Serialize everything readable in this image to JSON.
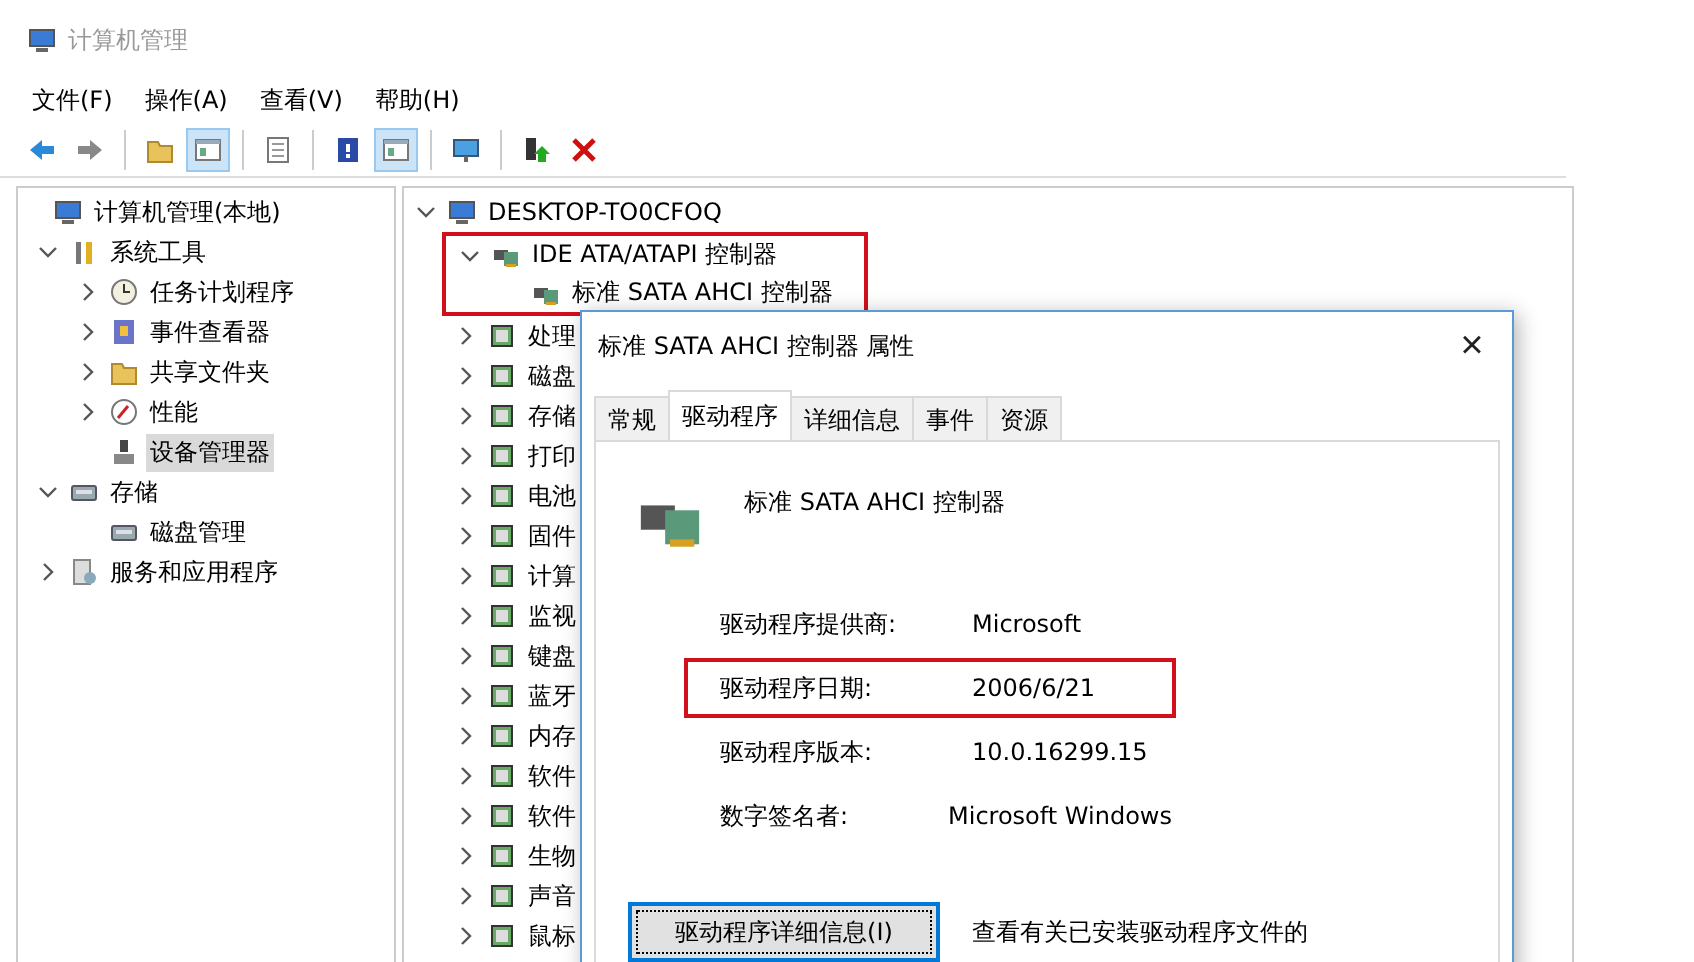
{
  "window": {
    "title": "计算机管理"
  },
  "menu": [
    "文件(F)",
    "操作(A)",
    "查看(V)",
    "帮助(H)"
  ],
  "toolbar": [
    [
      {
        "pressed": false
      },
      {
        "pressed": false
      }
    ],
    [
      {
        "pressed": false
      },
      {
        "pressed": true
      }
    ],
    [
      {
        "pressed": false
      }
    ],
    [
      {
        "pressed": false
      },
      {
        "pressed": true
      }
    ],
    [
      {
        "pressed": false
      }
    ],
    [
      {
        "pressed": false
      },
      {
        "pressed": false
      }
    ]
  ],
  "console_tree": [
    {
      "label": "计算机管理(本地)",
      "selected": false,
      "children": [
        {
          "label": "系统工具",
          "expanded": true,
          "selected": false,
          "children": [
            {
              "label": "任务计划程序",
              "expanded": false,
              "selected": false
            },
            {
              "label": "事件查看器",
              "expanded": false,
              "selected": false
            },
            {
              "label": "共享文件夹",
              "expanded": false,
              "selected": false
            },
            {
              "label": "性能",
              "expanded": false,
              "selected": false
            },
            {
              "label": "设备管理器",
              "selected": true
            }
          ]
        },
        {
          "label": "存储",
          "expanded": true,
          "selected": false,
          "children": [
            {
              "label": "磁盘管理",
              "selected": false
            }
          ]
        },
        {
          "label": "服务和应用程序",
          "expanded": false,
          "selected": false
        }
      ]
    }
  ],
  "device_tree": [
    {
      "label": "DESKTOP-TO0CFOQ",
      "expanded": true,
      "highlighted": false,
      "children": [
        {
          "label": "IDE ATA/ATAPI 控制器",
          "expanded": true,
          "highlighted": true,
          "children": [
            {
              "label": "标准 SATA AHCI 控制器",
              "highlighted": false
            }
          ]
        },
        {
          "label": "处理",
          "expanded": false,
          "highlighted": false
        },
        {
          "label": "磁盘",
          "expanded": false,
          "highlighted": false
        },
        {
          "label": "存储",
          "expanded": false,
          "highlighted": false
        },
        {
          "label": "打印",
          "expanded": false,
          "highlighted": false
        },
        {
          "label": "电池",
          "expanded": false,
          "highlighted": false
        },
        {
          "label": "固件",
          "expanded": false,
          "highlighted": false
        },
        {
          "label": "计算",
          "expanded": false,
          "highlighted": false
        },
        {
          "label": "监视",
          "expanded": false,
          "highlighted": false
        },
        {
          "label": "键盘",
          "expanded": false,
          "highlighted": false
        },
        {
          "label": "蓝牙",
          "expanded": false,
          "highlighted": false
        },
        {
          "label": "内存",
          "expanded": false,
          "highlighted": false
        },
        {
          "label": "软件",
          "expanded": false,
          "highlighted": false
        },
        {
          "label": "软件",
          "expanded": false,
          "highlighted": false
        },
        {
          "label": "生物",
          "expanded": false,
          "highlighted": false
        },
        {
          "label": "声音",
          "expanded": false,
          "highlighted": false
        },
        {
          "label": "鼠标",
          "expanded": false,
          "highlighted": false
        }
      ]
    }
  ],
  "dialog": {
    "title": "标准 SATA AHCI 控制器 属性",
    "close": "×",
    "tabs": [
      {
        "label": "常规",
        "selected": false
      },
      {
        "label": "驱动程序",
        "selected": true
      },
      {
        "label": "详细信息",
        "selected": false
      },
      {
        "label": "事件",
        "selected": false
      },
      {
        "label": "资源",
        "selected": false
      }
    ],
    "device_name": "标准 SATA AHCI 控制器",
    "fields": [
      {
        "label": "驱动程序提供商:",
        "value": "Microsoft",
        "highlighted": false
      },
      {
        "label": "驱动程序日期:",
        "value": "2006/6/21",
        "highlighted": true
      },
      {
        "label": "驱动程序版本:",
        "value": "10.0.16299.15",
        "highlighted": false
      },
      {
        "label": "数字签名者:",
        "value": "Microsoft Windows",
        "highlighted": false
      }
    ],
    "details_button": {
      "label": "驱动程序详细信息(I)",
      "focused": true
    },
    "details_description": "查看有关已安装驱动程序文件的"
  }
}
